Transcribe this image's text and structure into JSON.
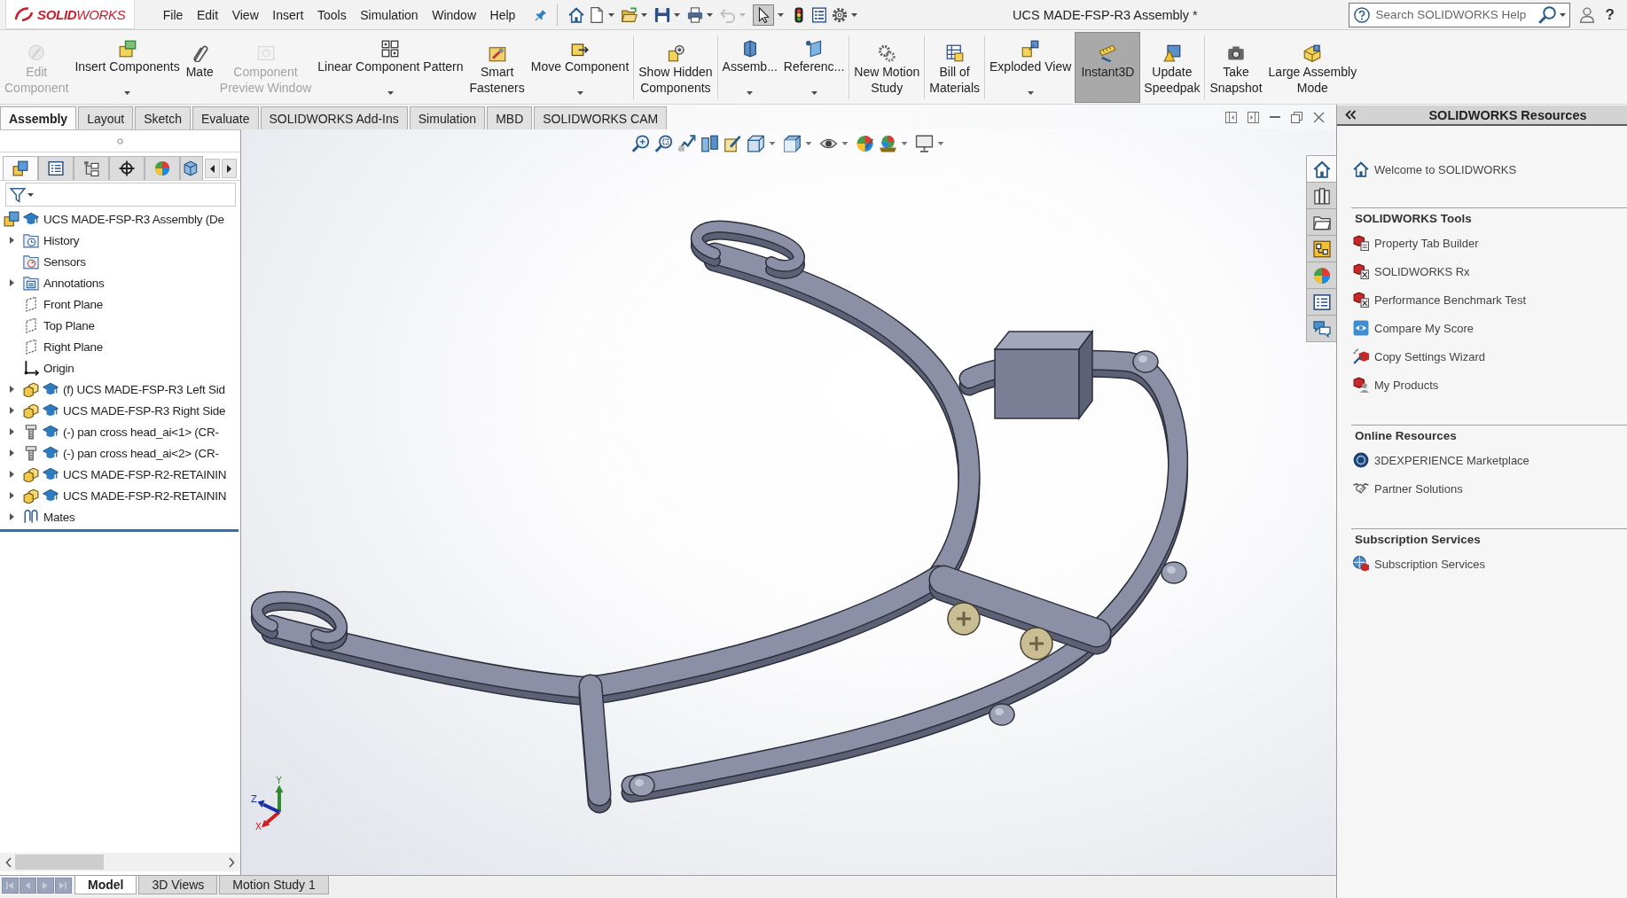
{
  "app": {
    "logo": "**SOLID**WORKS"
  },
  "menu": [
    "File",
    "Edit",
    "View",
    "Insert",
    "Tools",
    "Simulation",
    "Window",
    "Help"
  ],
  "quick_access": [
    {
      "dropdown": false,
      "disabled": false,
      "selected": false
    },
    {
      "dropdown": true,
      "disabled": false,
      "selected": false
    },
    {
      "dropdown": true,
      "disabled": false,
      "selected": false
    },
    {
      "dropdown": true,
      "disabled": false,
      "selected": false
    },
    {
      "dropdown": true,
      "disabled": false,
      "selected": false
    },
    {
      "dropdown": true,
      "disabled": true,
      "selected": false
    },
    {
      "dropdown": true,
      "disabled": false,
      "selected": true
    },
    {
      "dropdown": false,
      "disabled": false,
      "selected": false
    },
    {
      "dropdown": false,
      "disabled": false,
      "selected": false
    },
    {
      "dropdown": true,
      "disabled": false,
      "selected": false
    }
  ],
  "window": {
    "title": "UCS MADE-FSP-R3 Assembly *"
  },
  "search": {
    "placeholder": "Search SOLIDWORKS Help"
  },
  "help": "?",
  "command_groups": [
    [
      {
        "label": "Edit\nComponent",
        "dropdown": false,
        "disabled": true,
        "selected": false
      },
      {
        "label": "Insert Components",
        "dropdown": true,
        "disabled": false,
        "selected": false
      },
      {
        "label": "Mate",
        "dropdown": false,
        "disabled": false,
        "selected": false
      },
      {
        "label": "Component\nPreview Window",
        "dropdown": false,
        "disabled": true,
        "selected": false
      },
      {
        "label": "Linear Component Pattern",
        "dropdown": true,
        "disabled": false,
        "selected": false
      },
      {
        "label": "Smart\nFasteners",
        "dropdown": false,
        "disabled": false,
        "selected": false
      },
      {
        "label": "Move Component",
        "dropdown": true,
        "disabled": false,
        "selected": false
      }
    ],
    [
      {
        "label": "Show Hidden\nComponents",
        "dropdown": false,
        "disabled": false,
        "selected": false
      }
    ],
    [
      {
        "label": "Assemb...",
        "dropdown": true,
        "disabled": false,
        "selected": false
      },
      {
        "label": "Referenc...",
        "dropdown": true,
        "disabled": false,
        "selected": false
      }
    ],
    [
      {
        "label": "New Motion\nStudy",
        "dropdown": false,
        "disabled": false,
        "selected": false
      }
    ],
    [
      {
        "label": "Bill of\nMaterials",
        "dropdown": false,
        "disabled": false,
        "selected": false
      }
    ],
    [
      {
        "label": "Exploded View",
        "dropdown": true,
        "disabled": false,
        "selected": false
      },
      {
        "label": "Instant3D",
        "dropdown": false,
        "disabled": false,
        "selected": true
      },
      {
        "label": "Update\nSpeedpak",
        "dropdown": false,
        "disabled": false,
        "selected": false
      }
    ],
    [
      {
        "label": "Take\nSnapshot",
        "dropdown": false,
        "disabled": false,
        "selected": false
      },
      {
        "label": "Large Assembly\nMode",
        "dropdown": false,
        "disabled": false,
        "selected": false
      }
    ]
  ],
  "tabs": [
    {
      "label": "Assembly",
      "selected": true
    },
    {
      "label": "Layout",
      "selected": false
    },
    {
      "label": "Sketch",
      "selected": false
    },
    {
      "label": "Evaluate",
      "selected": false
    },
    {
      "label": "SOLIDWORKS Add-Ins",
      "selected": false
    },
    {
      "label": "Simulation",
      "selected": false
    },
    {
      "label": "MBD",
      "selected": false
    },
    {
      "label": "SOLIDWORKS CAM",
      "selected": false
    }
  ],
  "feature_tabs": [
    {
      "selected": true
    },
    {
      "selected": false
    },
    {
      "selected": false
    },
    {
      "selected": false
    },
    {
      "selected": false
    },
    {
      "selected": false
    }
  ],
  "tree": [
    {
      "label": "UCS MADE-FSP-R3 Assembly (De",
      "kind": "assembly",
      "collapsed": false,
      "children": [
        {
          "label": "History",
          "kind": "history",
          "collapsed": true
        },
        {
          "label": "Sensors",
          "kind": "sensors",
          "collapsed": false
        },
        {
          "label": "Annotations",
          "kind": "annotations",
          "collapsed": true
        },
        {
          "label": "Front Plane",
          "kind": "plane",
          "collapsed": false
        },
        {
          "label": "Top Plane",
          "kind": "plane",
          "collapsed": false
        },
        {
          "label": "Right Plane",
          "kind": "plane",
          "collapsed": false
        },
        {
          "label": "Origin",
          "kind": "origin",
          "collapsed": false
        },
        {
          "label": "(f) UCS MADE-FSP-R3 Left Sid",
          "kind": "part",
          "collapsed": true
        },
        {
          "label": "UCS MADE-FSP-R3 Right Side",
          "kind": "part",
          "collapsed": true
        },
        {
          "label": "(-) pan cross head_ai<1> (CR-",
          "kind": "fastener",
          "collapsed": true
        },
        {
          "label": "(-) pan cross head_ai<2> (CR-",
          "kind": "fastener",
          "collapsed": true
        },
        {
          "label": "UCS MADE-FSP-R2-RETAININ",
          "kind": "part",
          "collapsed": true
        },
        {
          "label": "UCS MADE-FSP-R2-RETAININ",
          "kind": "part",
          "collapsed": true
        },
        {
          "label": "Mates",
          "kind": "mates",
          "collapsed": true
        }
      ]
    }
  ],
  "view_toolbar": [
    {
      "dropdown": false
    },
    {
      "dropdown": false
    },
    {
      "dropdown": false
    },
    {
      "dropdown": false
    },
    {
      "dropdown": false
    },
    {
      "dropdown": true
    },
    {
      "dropdown": true
    },
    {
      "dropdown": true
    },
    {
      "dropdown": false
    },
    {
      "dropdown": true
    },
    {
      "dropdown": true
    }
  ],
  "triad": [
    {
      "label": "X",
      "color": "#cc1f1f"
    },
    {
      "label": "Y",
      "color": "#2e8b2e"
    },
    {
      "label": "Z",
      "color": "#1a2ea8"
    }
  ],
  "task_tabs": [
    {
      "selected": true
    },
    {
      "selected": false
    },
    {
      "selected": false
    },
    {
      "selected": false
    },
    {
      "selected": false
    },
    {
      "selected": false
    },
    {
      "selected": false
    }
  ],
  "resources": {
    "title": "SOLIDWORKS Resources",
    "sections": [
      {
        "items": [
          "Welcome to SOLIDWORKS"
        ]
      },
      {
        "heading": "SOLIDWORKS Tools",
        "items": [
          "Property Tab Builder",
          "SOLIDWORKS Rx",
          "Performance Benchmark Test",
          "Compare My Score",
          "Copy Settings Wizard",
          "My Products"
        ]
      },
      {
        "heading": "Online Resources",
        "items": [
          "3DEXPERIENCE Marketplace",
          "Partner Solutions"
        ]
      },
      {
        "heading": "Subscription Services",
        "items": [
          "Subscription Services"
        ]
      }
    ]
  },
  "bottom_tabs": [
    {
      "label": "Model",
      "selected": true
    },
    {
      "label": "3D Views",
      "selected": false
    },
    {
      "label": "Motion Study 1",
      "selected": false
    }
  ]
}
